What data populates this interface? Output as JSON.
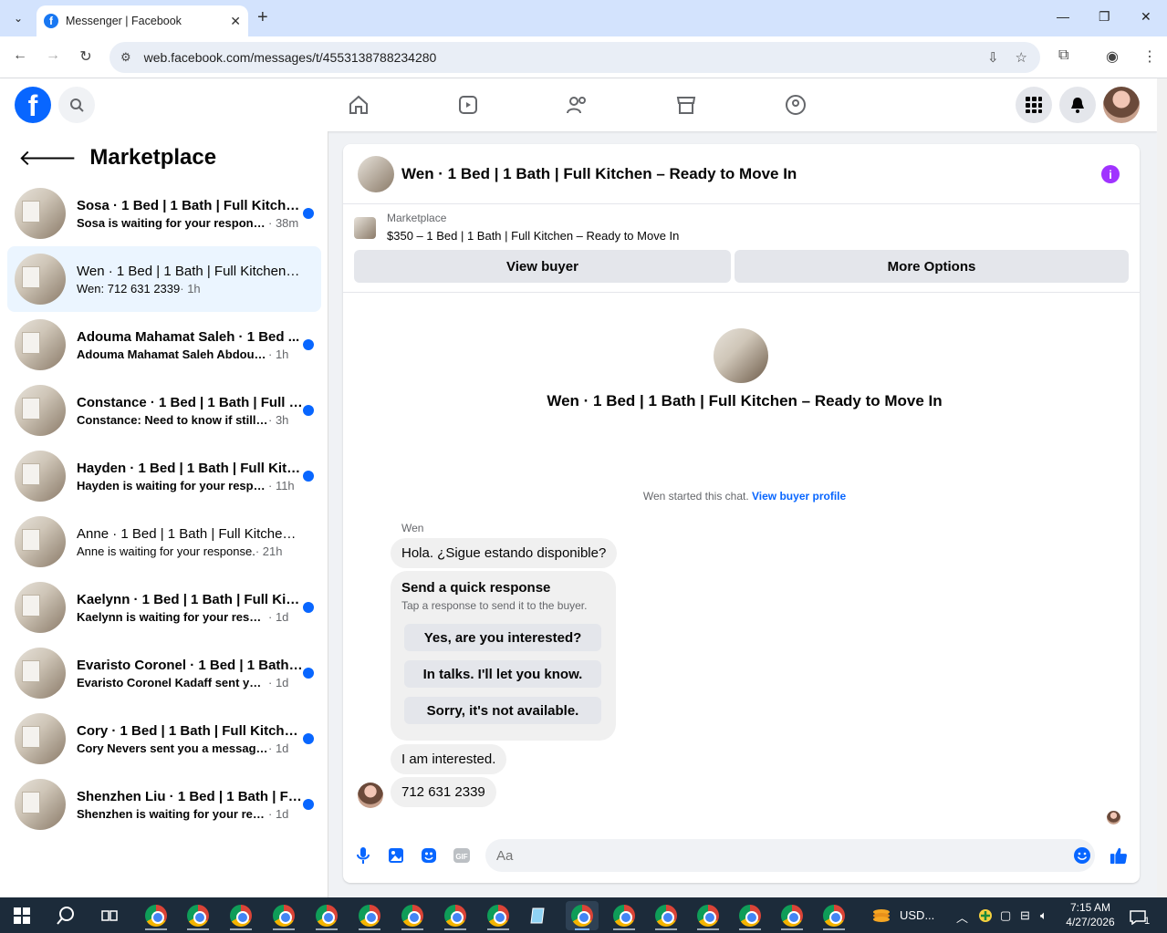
{
  "browser": {
    "tab_title": "Messenger | Facebook",
    "url": "web.facebook.com/messages/t/4553138788234280"
  },
  "sidebar": {
    "title": "Marketplace",
    "conversations": [
      {
        "name": "Sosa · 1 Bed | 1 Bath | Full Kitche...",
        "preview": "Sosa is waiting for your response.",
        "time": " · 38m",
        "unread": true
      },
      {
        "name": "Wen · 1 Bed | 1 Bath | Full Kitchen –...",
        "preview": "Wen: 712 631 2339",
        "time": " · 1h",
        "unread": false,
        "active": true
      },
      {
        "name": "Adouma Mahamat Saleh · 1 Bed ...",
        "preview": "Adouma Mahamat Saleh Abdoulla...",
        "time": " · 1h",
        "unread": true
      },
      {
        "name": "Constance · 1 Bed | 1 Bath | Full K...",
        "preview": "Constance: Need to know if still av...",
        "time": " · 3h",
        "unread": true
      },
      {
        "name": "Hayden · 1 Bed | 1 Bath | Full Kitc...",
        "preview": "Hayden is waiting for your respo...",
        "time": " · 11h",
        "unread": true
      },
      {
        "name": "Anne · 1 Bed | 1 Bath | Full Kitchen ...",
        "preview": "Anne is waiting for your response.",
        "time": " · 21h",
        "unread": false
      },
      {
        "name": "Kaelynn · 1 Bed | 1 Bath | Full Kitc...",
        "preview": "Kaelynn is waiting for your respon...",
        "time": " · 1d",
        "unread": true
      },
      {
        "name": "Evaristo Coronel · 1 Bed | 1 Bath |...",
        "preview": "Evaristo Coronel Kadaff sent you a ...",
        "time": " · 1d",
        "unread": true
      },
      {
        "name": "Cory · 1 Bed | 1 Bath | Full Kitche...",
        "preview": "Cory Nevers sent you a message a...",
        "time": " · 1d",
        "unread": true
      },
      {
        "name": "Shenzhen Liu · 1 Bed | 1 Bath | Fu...",
        "preview": "Shenzhen is waiting for your resp...",
        "time": " · 1d",
        "unread": true
      }
    ]
  },
  "chat": {
    "header_title": "Wen · 1 Bed | 1 Bath | Full Kitchen – Ready to Move In",
    "listing_label": "Marketplace",
    "listing_price": "$350 – 1 Bed | 1 Bath | Full Kitchen – Ready to Move In",
    "view_buyer": "View buyer",
    "more_options": "More Options",
    "center_title": "Wen · 1 Bed | 1 Bath | Full Kitchen – Ready to Move In",
    "started_text": "Wen started this chat.",
    "view_buyer_profile": "View buyer profile",
    "sender_name": "Wen",
    "msg1": "Hola. ¿Sigue estando disponible?",
    "quick_title": "Send a quick response",
    "quick_sub": "Tap a response to send it to the buyer.",
    "quick_replies": [
      "Yes, are you interested?",
      "In talks. I'll let you know.",
      "Sorry, it's not available."
    ],
    "msg2": "I am interested.",
    "msg3": "712 631 2339",
    "composer_placeholder": "Aa"
  },
  "taskbar": {
    "tray_label": "USD...",
    "time": "7:15 AM",
    "date": "4/27/2026",
    "notif_count": "1"
  },
  "colors": {
    "fb_blue": "#0866ff",
    "unread_dot": "#0866ff",
    "info_purple": "#a033ff"
  }
}
